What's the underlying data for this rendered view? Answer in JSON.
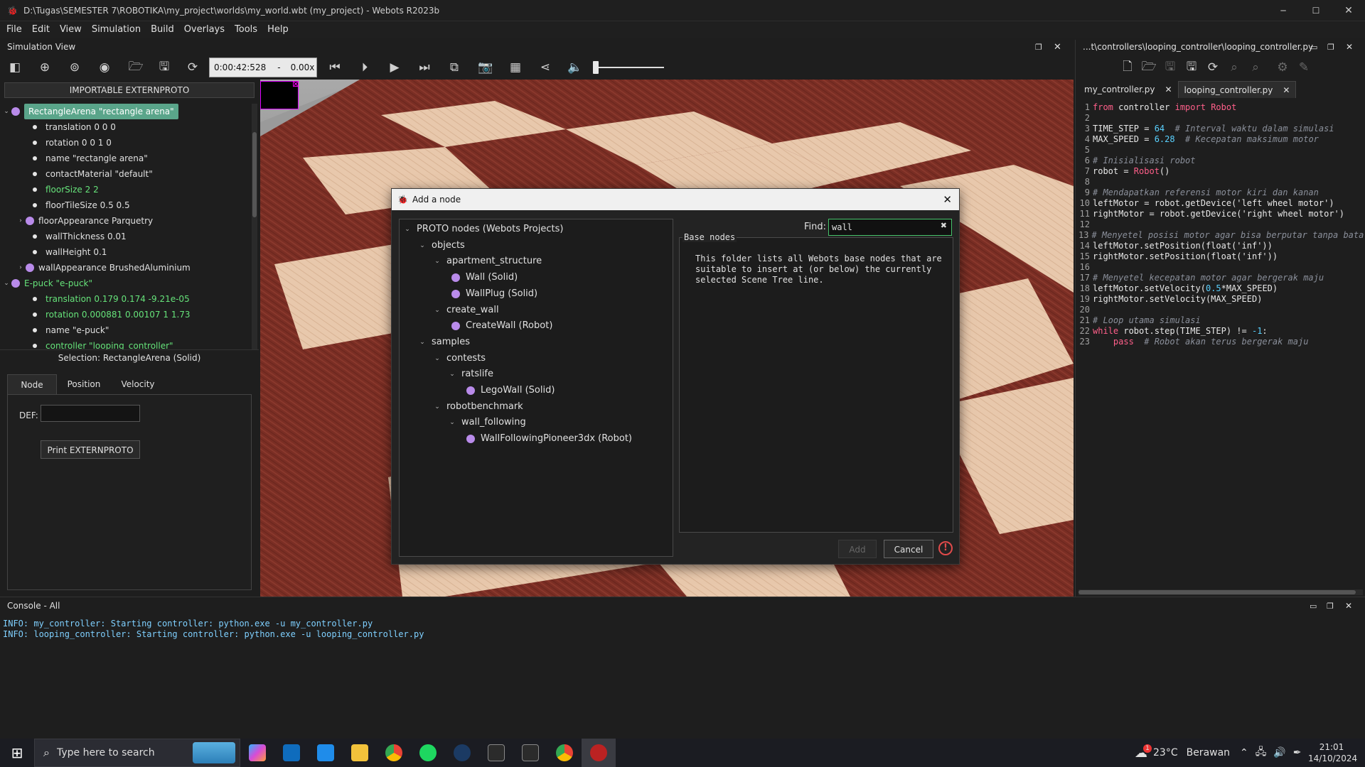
{
  "window": {
    "title": "D:\\Tugas\\SEMESTER 7\\ROBOTIKA\\my_project\\worlds\\my_world.wbt (my_project) - Webots R2023b"
  },
  "menu": [
    "File",
    "Edit",
    "View",
    "Simulation",
    "Build",
    "Overlays",
    "Tools",
    "Help"
  ],
  "sim_view": {
    "title": "Simulation View",
    "time": "0:00:42:528",
    "speed_sep": "-",
    "speed": "0.00x"
  },
  "scene_tree": {
    "header_button": "IMPORTABLE EXTERNPROTO",
    "rows": [
      {
        "text": "RectangleArena \"rectangle arena\"",
        "kind": "node",
        "expand": "v",
        "selected": true
      },
      {
        "text": "translation 0 0 0",
        "kind": "field"
      },
      {
        "text": "rotation 0 0 1 0",
        "kind": "field"
      },
      {
        "text": "name \"rectangle arena\"",
        "kind": "field"
      },
      {
        "text": "contactMaterial \"default\"",
        "kind": "field"
      },
      {
        "text": "floorSize 2 2",
        "kind": "field",
        "green": true
      },
      {
        "text": "floorTileSize 0.5 0.5",
        "kind": "field"
      },
      {
        "text": "floorAppearance Parquetry",
        "kind": "subnode",
        "expand": ">"
      },
      {
        "text": "wallThickness 0.01",
        "kind": "field"
      },
      {
        "text": "wallHeight 0.1",
        "kind": "field"
      },
      {
        "text": "wallAppearance BrushedAluminium",
        "kind": "subnode",
        "expand": ">"
      },
      {
        "text": "E-puck \"e-puck\"",
        "kind": "node",
        "expand": "v",
        "green": true
      },
      {
        "text": "translation 0.179 0.174 -9.21e-05",
        "kind": "field",
        "green": true
      },
      {
        "text": "rotation 0.000881 0.00107 1 1.73",
        "kind": "field",
        "green": true
      },
      {
        "text": "name \"e-puck\"",
        "kind": "field"
      },
      {
        "text": "controller \"looping_controller\"",
        "kind": "field",
        "green": true
      }
    ]
  },
  "selection": {
    "label": "Selection: RectangleArena (Solid)",
    "tabs": [
      "Node",
      "Position",
      "Velocity"
    ],
    "def_label": "DEF:",
    "def_value": "",
    "print_button": "Print EXTERNPROTO"
  },
  "dialog": {
    "title": "Add a node",
    "find_label": "Find:",
    "find_value": "wall",
    "tree": [
      {
        "text": "PROTO nodes (Webots Projects)",
        "level": 0,
        "expand": "v"
      },
      {
        "text": "objects",
        "level": 1,
        "expand": "v"
      },
      {
        "text": "apartment_structure",
        "level": 2,
        "expand": "v"
      },
      {
        "text": "Wall (Solid)",
        "level": 3,
        "dot": true
      },
      {
        "text": "WallPlug (Solid)",
        "level": 3,
        "dot": true
      },
      {
        "text": "create_wall",
        "level": 2,
        "expand": "v"
      },
      {
        "text": "CreateWall (Robot)",
        "level": 3,
        "dot": true
      },
      {
        "text": "samples",
        "level": 1,
        "expand": "v"
      },
      {
        "text": "contests",
        "level": 2,
        "expand": "v"
      },
      {
        "text": "ratslife",
        "level": 3,
        "expand": "v"
      },
      {
        "text": "LegoWall (Solid)",
        "level": 4,
        "dot": true
      },
      {
        "text": "robotbenchmark",
        "level": 2,
        "expand": "v"
      },
      {
        "text": "wall_following",
        "level": 3,
        "expand": "v"
      },
      {
        "text": "WallFollowingPioneer3dx (Robot)",
        "level": 4,
        "dot": true
      }
    ],
    "info_title": "Base nodes",
    "info_text": "This folder lists all Webots base nodes that are\nsuitable to insert at (or below) the currently\nselected Scene Tree line.",
    "add_button": "Add",
    "cancel_button": "Cancel"
  },
  "editor": {
    "path": "...t\\controllers\\looping_controller\\looping_controller.py",
    "tabs": [
      "my_controller.py",
      "looping_controller.py"
    ],
    "active_tab": 1
  },
  "code": [
    [
      [
        "kw",
        "from"
      ],
      [
        "t",
        " controller "
      ],
      [
        "kw",
        "import"
      ],
      [
        "cls",
        " Robot"
      ]
    ],
    [],
    [
      [
        "t",
        "TIME_STEP = "
      ],
      [
        "num",
        "64"
      ],
      [
        "cm",
        "  # Interval waktu dalam simulasi"
      ]
    ],
    [
      [
        "t",
        "MAX_SPEED = "
      ],
      [
        "num",
        "6.28"
      ],
      [
        "cm",
        "  # Kecepatan maksimum motor"
      ]
    ],
    [],
    [
      [
        "cm",
        "# Inisialisasi robot"
      ]
    ],
    [
      [
        "t",
        "robot = "
      ],
      [
        "cls",
        "Robot"
      ],
      [
        "t",
        "()"
      ]
    ],
    [],
    [
      [
        "cm",
        "# Mendapatkan referensi motor kiri dan kanan"
      ]
    ],
    [
      [
        "t",
        "leftMotor = robot.getDevice('left wheel motor')"
      ]
    ],
    [
      [
        "t",
        "rightMotor = robot.getDevice('right wheel motor')"
      ]
    ],
    [],
    [
      [
        "cm",
        "# Menyetel posisi motor agar bisa berputar tanpa batas"
      ]
    ],
    [
      [
        "t",
        "leftMotor.setPosition(float('inf'))"
      ]
    ],
    [
      [
        "t",
        "rightMotor.setPosition(float('inf'))"
      ]
    ],
    [],
    [
      [
        "cm",
        "# Menyetel kecepatan motor agar bergerak maju"
      ]
    ],
    [
      [
        "t",
        "leftMotor.setVelocity("
      ],
      [
        "num",
        "0.5"
      ],
      [
        "t",
        "*MAX_SPEED)"
      ]
    ],
    [
      [
        "t",
        "rightMotor.setVelocity(MAX_SPEED)"
      ]
    ],
    [],
    [
      [
        "cm",
        "# Loop utama simulasi"
      ]
    ],
    [
      [
        "kw",
        "while"
      ],
      [
        "t",
        " robot.step(TIME_STEP) != "
      ],
      [
        "num",
        "-1"
      ],
      [
        "t",
        ":"
      ]
    ],
    [
      [
        "t",
        "    "
      ],
      [
        "kw",
        "pass"
      ],
      [
        "cm",
        "  # Robot akan terus bergerak maju"
      ]
    ]
  ],
  "console": {
    "title": "Console - All",
    "lines": [
      "INFO: my_controller: Starting controller: python.exe -u my_controller.py",
      "INFO: looping_controller: Starting controller: python.exe -u looping_controller.py"
    ]
  },
  "taskbar": {
    "search_placeholder": "Type here to search",
    "weather_temp": "23°C",
    "weather_desc": "Berawan",
    "weather_badge": "1",
    "time": "21:01",
    "date": "14/10/2024"
  },
  "colors": {
    "accent_green": "#66e37a",
    "node_purple": "#b98bea",
    "keyword": "#ff5f8a",
    "number": "#5ad1ff"
  }
}
